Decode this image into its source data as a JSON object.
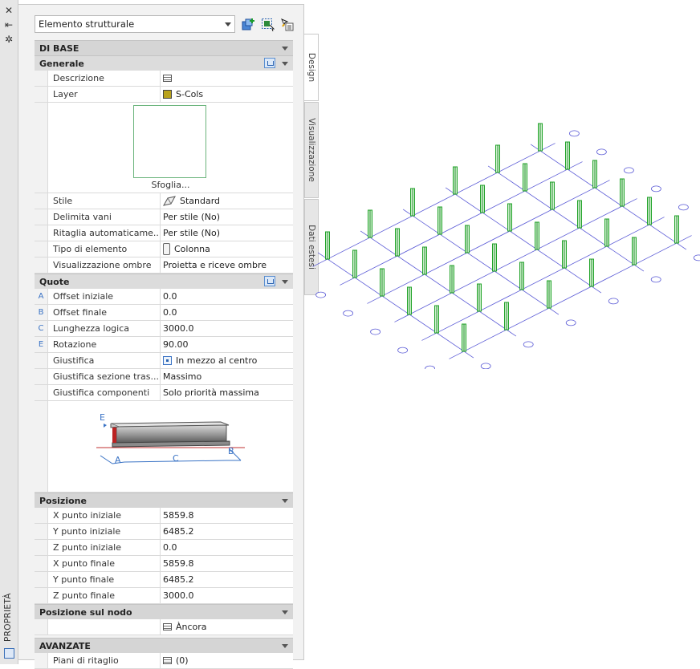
{
  "palette": {
    "title": "PROPRIETÀ",
    "object_type": "Elemento strutturale",
    "tabs": [
      "Design",
      "Visualizzazione",
      "Dati estesi"
    ]
  },
  "sections": {
    "basic": "DI BASE",
    "general": "Generale",
    "dimensions": "Quote",
    "position": "Posizione",
    "node_position": "Posizione sul nodo",
    "advanced": "AVANZATE"
  },
  "general": {
    "description_label": "Descrizione",
    "layer_label": "Layer",
    "layer_value": "S-Cols",
    "browse": "Sfoglia...",
    "style_label": "Stile",
    "style_value": "Standard",
    "bound_label": "Delimita vani",
    "bound_value": "Per stile (No)",
    "trim_label": "Ritaglia  automaticame...",
    "trim_value": "Per stile (No)",
    "member_type_label": "Tipo di elemento",
    "member_type_value": "Colonna",
    "shadow_label": "Visualizzazione ombre",
    "shadow_value": "Proietta e riceve ombre"
  },
  "dimensions": {
    "rows": [
      {
        "key": "A",
        "label": "Offset iniziale",
        "value": "0.0"
      },
      {
        "key": "B",
        "label": "Offset finale",
        "value": "0.0"
      },
      {
        "key": "C",
        "label": "Lunghezza logica",
        "value": "3000.0"
      },
      {
        "key": "E",
        "label": "Rotazione",
        "value": "90.00"
      }
    ],
    "justify_label": "Giustifica",
    "justify_value": "In mezzo al centro",
    "justify_cross_label": "Giustifica  sezione  tras...",
    "justify_cross_value": "Massimo",
    "justify_comp_label": "Giustifica componenti",
    "justify_comp_value": "Solo priorità massima",
    "diagram_labels": {
      "e": "E",
      "a": "A",
      "c": "C",
      "b": "B"
    }
  },
  "position": {
    "rows": [
      {
        "label": "X punto iniziale",
        "value": "5859.8"
      },
      {
        "label": "Y punto iniziale",
        "value": "6485.2"
      },
      {
        "label": "Z punto iniziale",
        "value": "0.0"
      },
      {
        "label": "X punto finale",
        "value": "5859.8"
      },
      {
        "label": "Y punto finale",
        "value": "6485.2"
      },
      {
        "label": "Z punto finale",
        "value": "3000.0"
      }
    ]
  },
  "node": {
    "anchor": "Àncora"
  },
  "advanced": {
    "trim_planes_label": "Piani di ritaglio",
    "trim_planes_value": "(0)"
  },
  "colors": {
    "grid": "#5a5ad6",
    "column": "#22a32a",
    "accent": "#3a73c5"
  }
}
